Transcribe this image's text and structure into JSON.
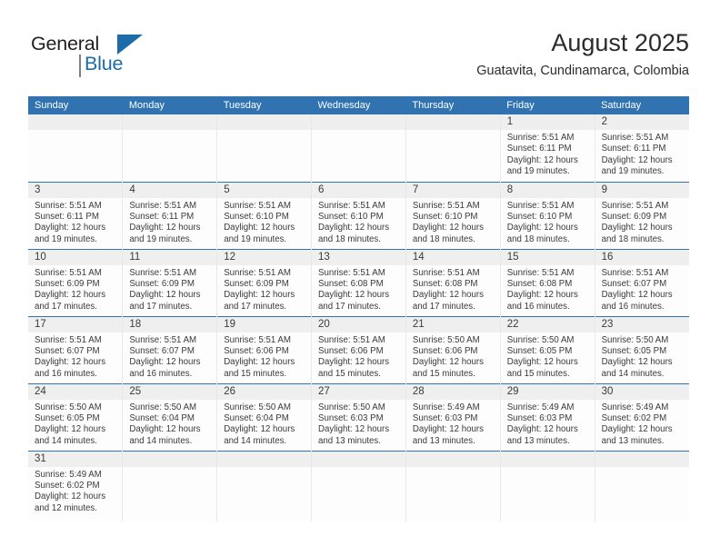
{
  "brand": {
    "name_top": "General",
    "name_bottom": "Blue",
    "accent_color": "#1b6ca8"
  },
  "header": {
    "title": "August 2025",
    "subtitle": "Guatavita, Cundinamarca, Colombia"
  },
  "theme": {
    "header_blue": "#3173b0",
    "daynum_band": "#efefef",
    "text": "#3a3a3a"
  },
  "labels": {
    "sunrise_prefix": "Sunrise:",
    "sunset_prefix": "Sunset:",
    "daylight_prefix": "Daylight:"
  },
  "columns": [
    "Sunday",
    "Monday",
    "Tuesday",
    "Wednesday",
    "Thursday",
    "Friday",
    "Saturday"
  ],
  "weeks": [
    [
      {
        "day": "",
        "empty": true
      },
      {
        "day": "",
        "empty": true
      },
      {
        "day": "",
        "empty": true
      },
      {
        "day": "",
        "empty": true
      },
      {
        "day": "",
        "empty": true
      },
      {
        "day": "1",
        "sunrise": "Sunrise: 5:51 AM",
        "sunset": "Sunset: 6:11 PM",
        "daylight1": "Daylight: 12 hours",
        "daylight2": "and 19 minutes."
      },
      {
        "day": "2",
        "sunrise": "Sunrise: 5:51 AM",
        "sunset": "Sunset: 6:11 PM",
        "daylight1": "Daylight: 12 hours",
        "daylight2": "and 19 minutes."
      }
    ],
    [
      {
        "day": "3",
        "sunrise": "Sunrise: 5:51 AM",
        "sunset": "Sunset: 6:11 PM",
        "daylight1": "Daylight: 12 hours",
        "daylight2": "and 19 minutes."
      },
      {
        "day": "4",
        "sunrise": "Sunrise: 5:51 AM",
        "sunset": "Sunset: 6:11 PM",
        "daylight1": "Daylight: 12 hours",
        "daylight2": "and 19 minutes."
      },
      {
        "day": "5",
        "sunrise": "Sunrise: 5:51 AM",
        "sunset": "Sunset: 6:10 PM",
        "daylight1": "Daylight: 12 hours",
        "daylight2": "and 19 minutes."
      },
      {
        "day": "6",
        "sunrise": "Sunrise: 5:51 AM",
        "sunset": "Sunset: 6:10 PM",
        "daylight1": "Daylight: 12 hours",
        "daylight2": "and 18 minutes."
      },
      {
        "day": "7",
        "sunrise": "Sunrise: 5:51 AM",
        "sunset": "Sunset: 6:10 PM",
        "daylight1": "Daylight: 12 hours",
        "daylight2": "and 18 minutes."
      },
      {
        "day": "8",
        "sunrise": "Sunrise: 5:51 AM",
        "sunset": "Sunset: 6:10 PM",
        "daylight1": "Daylight: 12 hours",
        "daylight2": "and 18 minutes."
      },
      {
        "day": "9",
        "sunrise": "Sunrise: 5:51 AM",
        "sunset": "Sunset: 6:09 PM",
        "daylight1": "Daylight: 12 hours",
        "daylight2": "and 18 minutes."
      }
    ],
    [
      {
        "day": "10",
        "sunrise": "Sunrise: 5:51 AM",
        "sunset": "Sunset: 6:09 PM",
        "daylight1": "Daylight: 12 hours",
        "daylight2": "and 17 minutes."
      },
      {
        "day": "11",
        "sunrise": "Sunrise: 5:51 AM",
        "sunset": "Sunset: 6:09 PM",
        "daylight1": "Daylight: 12 hours",
        "daylight2": "and 17 minutes."
      },
      {
        "day": "12",
        "sunrise": "Sunrise: 5:51 AM",
        "sunset": "Sunset: 6:09 PM",
        "daylight1": "Daylight: 12 hours",
        "daylight2": "and 17 minutes."
      },
      {
        "day": "13",
        "sunrise": "Sunrise: 5:51 AM",
        "sunset": "Sunset: 6:08 PM",
        "daylight1": "Daylight: 12 hours",
        "daylight2": "and 17 minutes."
      },
      {
        "day": "14",
        "sunrise": "Sunrise: 5:51 AM",
        "sunset": "Sunset: 6:08 PM",
        "daylight1": "Daylight: 12 hours",
        "daylight2": "and 17 minutes."
      },
      {
        "day": "15",
        "sunrise": "Sunrise: 5:51 AM",
        "sunset": "Sunset: 6:08 PM",
        "daylight1": "Daylight: 12 hours",
        "daylight2": "and 16 minutes."
      },
      {
        "day": "16",
        "sunrise": "Sunrise: 5:51 AM",
        "sunset": "Sunset: 6:07 PM",
        "daylight1": "Daylight: 12 hours",
        "daylight2": "and 16 minutes."
      }
    ],
    [
      {
        "day": "17",
        "sunrise": "Sunrise: 5:51 AM",
        "sunset": "Sunset: 6:07 PM",
        "daylight1": "Daylight: 12 hours",
        "daylight2": "and 16 minutes."
      },
      {
        "day": "18",
        "sunrise": "Sunrise: 5:51 AM",
        "sunset": "Sunset: 6:07 PM",
        "daylight1": "Daylight: 12 hours",
        "daylight2": "and 16 minutes."
      },
      {
        "day": "19",
        "sunrise": "Sunrise: 5:51 AM",
        "sunset": "Sunset: 6:06 PM",
        "daylight1": "Daylight: 12 hours",
        "daylight2": "and 15 minutes."
      },
      {
        "day": "20",
        "sunrise": "Sunrise: 5:51 AM",
        "sunset": "Sunset: 6:06 PM",
        "daylight1": "Daylight: 12 hours",
        "daylight2": "and 15 minutes."
      },
      {
        "day": "21",
        "sunrise": "Sunrise: 5:50 AM",
        "sunset": "Sunset: 6:06 PM",
        "daylight1": "Daylight: 12 hours",
        "daylight2": "and 15 minutes."
      },
      {
        "day": "22",
        "sunrise": "Sunrise: 5:50 AM",
        "sunset": "Sunset: 6:05 PM",
        "daylight1": "Daylight: 12 hours",
        "daylight2": "and 15 minutes."
      },
      {
        "day": "23",
        "sunrise": "Sunrise: 5:50 AM",
        "sunset": "Sunset: 6:05 PM",
        "daylight1": "Daylight: 12 hours",
        "daylight2": "and 14 minutes."
      }
    ],
    [
      {
        "day": "24",
        "sunrise": "Sunrise: 5:50 AM",
        "sunset": "Sunset: 6:05 PM",
        "daylight1": "Daylight: 12 hours",
        "daylight2": "and 14 minutes."
      },
      {
        "day": "25",
        "sunrise": "Sunrise: 5:50 AM",
        "sunset": "Sunset: 6:04 PM",
        "daylight1": "Daylight: 12 hours",
        "daylight2": "and 14 minutes."
      },
      {
        "day": "26",
        "sunrise": "Sunrise: 5:50 AM",
        "sunset": "Sunset: 6:04 PM",
        "daylight1": "Daylight: 12 hours",
        "daylight2": "and 14 minutes."
      },
      {
        "day": "27",
        "sunrise": "Sunrise: 5:50 AM",
        "sunset": "Sunset: 6:03 PM",
        "daylight1": "Daylight: 12 hours",
        "daylight2": "and 13 minutes."
      },
      {
        "day": "28",
        "sunrise": "Sunrise: 5:49 AM",
        "sunset": "Sunset: 6:03 PM",
        "daylight1": "Daylight: 12 hours",
        "daylight2": "and 13 minutes."
      },
      {
        "day": "29",
        "sunrise": "Sunrise: 5:49 AM",
        "sunset": "Sunset: 6:03 PM",
        "daylight1": "Daylight: 12 hours",
        "daylight2": "and 13 minutes."
      },
      {
        "day": "30",
        "sunrise": "Sunrise: 5:49 AM",
        "sunset": "Sunset: 6:02 PM",
        "daylight1": "Daylight: 12 hours",
        "daylight2": "and 13 minutes."
      }
    ],
    [
      {
        "day": "31",
        "sunrise": "Sunrise: 5:49 AM",
        "sunset": "Sunset: 6:02 PM",
        "daylight1": "Daylight: 12 hours",
        "daylight2": "and 12 minutes."
      },
      {
        "day": "",
        "empty": true
      },
      {
        "day": "",
        "empty": true
      },
      {
        "day": "",
        "empty": true
      },
      {
        "day": "",
        "empty": true
      },
      {
        "day": "",
        "empty": true
      },
      {
        "day": "",
        "empty": true
      }
    ]
  ]
}
